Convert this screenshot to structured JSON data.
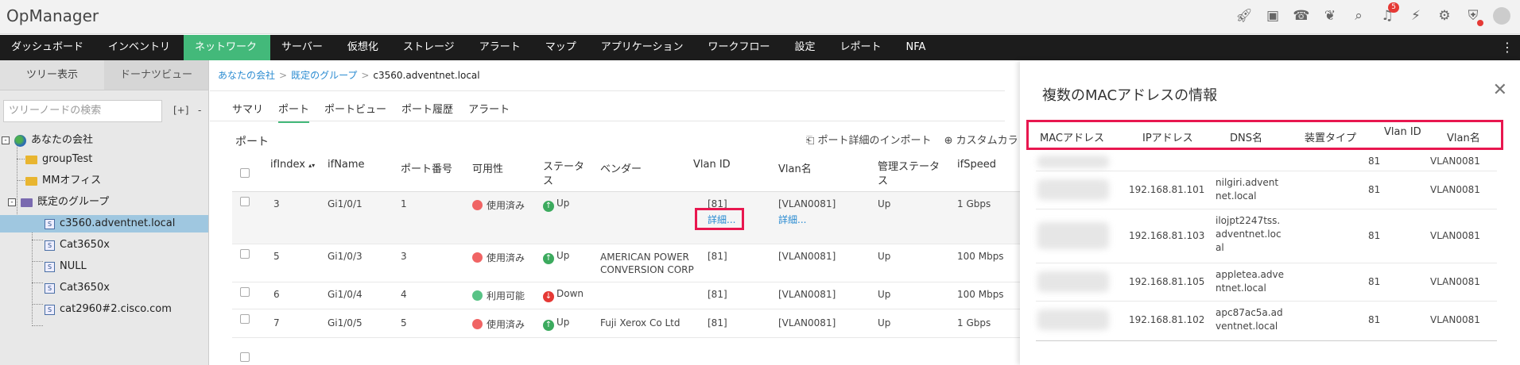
{
  "app": {
    "title": "OpManager",
    "notification_count": "5"
  },
  "top_icons": [
    "rocket-icon",
    "presentation-icon",
    "phone-icon",
    "gift-icon",
    "search-icon",
    "bell-icon",
    "plug-icon",
    "gear-icon",
    "alert-shield-icon",
    "user-avatar-icon"
  ],
  "nav": {
    "items": [
      "ダッシュボード",
      "インベントリ",
      "ネットワーク",
      "サーバー",
      "仮想化",
      "ストレージ",
      "アラート",
      "マップ",
      "アプリケーション",
      "ワークフロー",
      "設定",
      "レポート",
      "NFA"
    ],
    "active": "ネットワーク"
  },
  "sidebar": {
    "tabs": [
      "ツリー表示",
      "ドーナツビュー"
    ],
    "search_placeholder": "ツリーノードの検索",
    "add_label": "[+]",
    "dash_label": "-",
    "tree": [
      {
        "label": "あなたの会社"
      },
      {
        "label": "groupTest"
      },
      {
        "label": "MMオフィス"
      },
      {
        "label": "既定のグループ"
      },
      {
        "label": "c3560.adventnet.local"
      },
      {
        "label": "Cat3650x"
      },
      {
        "label": "NULL"
      },
      {
        "label": "Cat3650x"
      },
      {
        "label": "cat2960#2.cisco.com"
      }
    ],
    "toggles": [
      "-",
      "-"
    ]
  },
  "breadcrumb": {
    "root": "あなたの会社",
    "group": "既定のグループ",
    "current": "c3560.adventnet.local",
    "separator": ">"
  },
  "subtabs": [
    "サマリ",
    "ポート",
    "ポートビュー",
    "ポート履歴",
    "アラート"
  ],
  "ports": {
    "title": "ポート",
    "actions": [
      "ポート詳細のインポート",
      "カスタムカラ"
    ],
    "headers": [
      "ifIndex",
      "ifName",
      "ポート番号",
      "可用性",
      "ステータス",
      "ベンダー",
      "Vlan ID",
      "Vlan名",
      "管理ステータス",
      "ifSpeed"
    ],
    "rows": [
      {
        "ifIndex": "3",
        "ifName": "Gi1/0/1",
        "port": "1",
        "availability": "使用済み",
        "status": "Up",
        "vendor": "",
        "vlan_id": "[81]",
        "vlan_link": "詳細...",
        "vlan_name": "[VLAN0081]",
        "vlan_name_link": "詳細...",
        "admin": "Up",
        "speed": "1 Gbps"
      },
      {
        "ifIndex": "5",
        "ifName": "Gi1/0/3",
        "port": "3",
        "availability": "使用済み",
        "status": "Up",
        "vendor": "AMERICAN POWER CONVERSION CORP",
        "vlan_id": "[81]",
        "vlan_name": "[VLAN0081]",
        "admin": "Up",
        "speed": "100 Mbps"
      },
      {
        "ifIndex": "6",
        "ifName": "Gi1/0/4",
        "port": "4",
        "availability": "利用可能",
        "status": "Down",
        "vendor": "",
        "vlan_id": "[81]",
        "vlan_name": "[VLAN0081]",
        "admin": "Up",
        "speed": "100 Mbps"
      },
      {
        "ifIndex": "7",
        "ifName": "Gi1/0/5",
        "port": "5",
        "availability": "使用済み",
        "status": "Up",
        "vendor": "Fuji Xerox Co Ltd",
        "vlan_id": "[81]",
        "vlan_name": "[VLAN0081]",
        "admin": "Up",
        "speed": "1 Gbps"
      }
    ]
  },
  "panel": {
    "title": "複数のMACアドレスの情報",
    "headers": [
      "MACアドレス",
      "IPアドレス",
      "DNS名",
      "装置タイプ",
      "Vlan ID",
      "Vlan名"
    ],
    "rows": [
      {
        "ip": "",
        "dns": "",
        "type": "",
        "vlan_id": "81",
        "vlan_name": "VLAN0081"
      },
      {
        "ip": "192.168.81.101",
        "dns": "nilgiri.adventnet.local",
        "type": "",
        "vlan_id": "81",
        "vlan_name": "VLAN0081"
      },
      {
        "ip": "192.168.81.103",
        "dns": "ilojpt2247tss.adventnet.local",
        "type": "",
        "vlan_id": "81",
        "vlan_name": "VLAN0081"
      },
      {
        "ip": "192.168.81.105",
        "dns": "appletea.adventnet.local",
        "type": "",
        "vlan_id": "81",
        "vlan_name": "VLAN0081"
      },
      {
        "ip": "192.168.81.102",
        "dns": "apc87ac5a.adventnet.local",
        "type": "",
        "vlan_id": "81",
        "vlan_name": "VLAN0081"
      }
    ]
  },
  "colors": {
    "accent_green": "#43b97a",
    "highlight": "#e8174f",
    "link": "#2a8bd1",
    "nav_bg": "#1c1c1c"
  }
}
